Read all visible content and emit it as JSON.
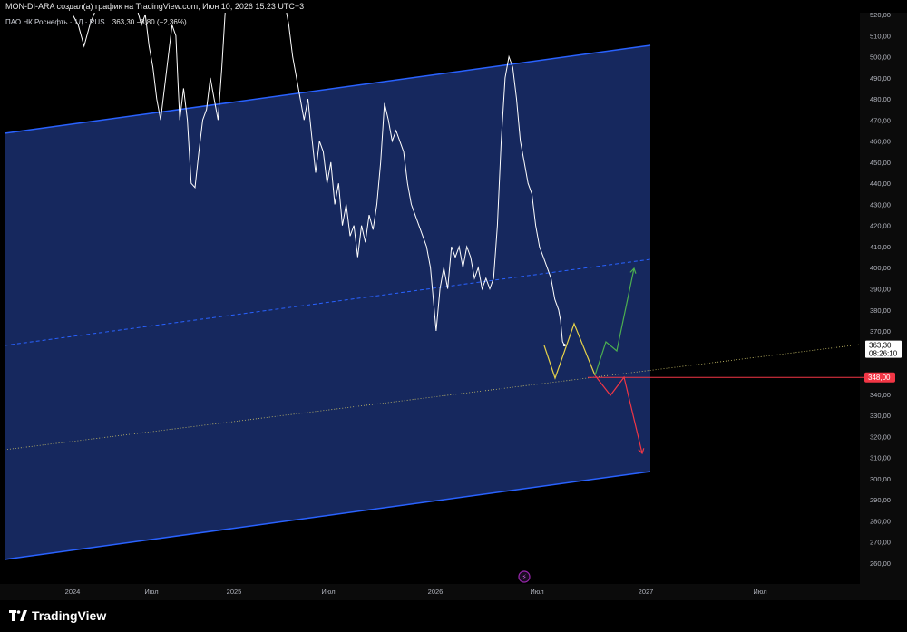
{
  "header": {
    "attribution": "MON-DI-ARA создал(а) график на TradingView.com, Июн 10, 2026 15:23 UTC+3"
  },
  "chart_data": {
    "type": "line",
    "symbol": "ПАО НК Роснефть · 1Д · RUS",
    "price_info": "363,30 −8,80 (−2,36%)",
    "x_ticks": [
      "2024",
      "Июл",
      "2025",
      "Июл",
      "2026",
      "Июл",
      "2027",
      "Июл"
    ],
    "y_ticks": [
      "520,00",
      "510,00",
      "500,00",
      "490,00",
      "480,00",
      "470,00",
      "460,00",
      "450,00",
      "440,00",
      "430,00",
      "420,00",
      "410,00",
      "400,00",
      "390,00",
      "380,00",
      "370,00",
      "360,00",
      "350,00",
      "340,00",
      "330,00",
      "320,00",
      "310,00",
      "300,00",
      "290,00",
      "280,00",
      "270,00",
      "260,00"
    ],
    "ylim": [
      255,
      521
    ],
    "last_price": {
      "value": 363.3,
      "label": "363,30",
      "countdown": "08:26:10"
    },
    "level_line": {
      "value": 348.0,
      "label": "348,00",
      "color": "#f23645"
    },
    "grid": false,
    "series": [
      {
        "values": [
          [
            2024.0,
            520
          ],
          [
            2024.03,
            515
          ],
          [
            2024.06,
            505
          ],
          [
            2024.09,
            515
          ],
          [
            2024.12,
            522
          ],
          [
            2024.15,
            530
          ],
          [
            2024.18,
            525
          ],
          [
            2024.21,
            535
          ],
          [
            2024.24,
            530
          ],
          [
            2024.27,
            535
          ],
          [
            2024.3,
            530
          ],
          [
            2024.33,
            525
          ],
          [
            2024.36,
            515
          ],
          [
            2024.38,
            520
          ],
          [
            2024.4,
            505
          ],
          [
            2024.42,
            495
          ],
          [
            2024.44,
            480
          ],
          [
            2024.46,
            470
          ],
          [
            2024.48,
            485
          ],
          [
            2024.5,
            500
          ],
          [
            2024.52,
            515
          ],
          [
            2024.54,
            510
          ],
          [
            2024.55,
            490
          ],
          [
            2024.56,
            470
          ],
          [
            2024.58,
            485
          ],
          [
            2024.6,
            470
          ],
          [
            2024.62,
            440
          ],
          [
            2024.64,
            438
          ],
          [
            2024.66,
            455
          ],
          [
            2024.68,
            470
          ],
          [
            2024.7,
            475
          ],
          [
            2024.72,
            490
          ],
          [
            2024.74,
            480
          ],
          [
            2024.76,
            470
          ],
          [
            2024.78,
            495
          ],
          [
            2024.8,
            525
          ],
          [
            2024.82,
            530
          ],
          [
            2024.84,
            525
          ],
          [
            2024.86,
            535
          ],
          [
            2024.88,
            530
          ],
          [
            2024.9,
            535
          ],
          [
            2024.93,
            530
          ],
          [
            2024.96,
            540
          ],
          [
            2025.0,
            535
          ],
          [
            2025.03,
            530
          ],
          [
            2025.06,
            540
          ],
          [
            2025.09,
            535
          ],
          [
            2025.11,
            525
          ],
          [
            2025.13,
            515
          ],
          [
            2025.15,
            500
          ],
          [
            2025.17,
            490
          ],
          [
            2025.19,
            480
          ],
          [
            2025.21,
            470
          ],
          [
            2025.23,
            480
          ],
          [
            2025.25,
            462
          ],
          [
            2025.27,
            445
          ],
          [
            2025.29,
            460
          ],
          [
            2025.31,
            455
          ],
          [
            2025.33,
            440
          ],
          [
            2025.35,
            450
          ],
          [
            2025.37,
            430
          ],
          [
            2025.39,
            440
          ],
          [
            2025.41,
            420
          ],
          [
            2025.43,
            430
          ],
          [
            2025.45,
            415
          ],
          [
            2025.47,
            420
          ],
          [
            2025.49,
            405
          ],
          [
            2025.51,
            420
          ],
          [
            2025.53,
            412
          ],
          [
            2025.55,
            425
          ],
          [
            2025.57,
            418
          ],
          [
            2025.59,
            430
          ],
          [
            2025.61,
            450
          ],
          [
            2025.63,
            478
          ],
          [
            2025.65,
            470
          ],
          [
            2025.67,
            460
          ],
          [
            2025.69,
            465
          ],
          [
            2025.71,
            460
          ],
          [
            2025.73,
            455
          ],
          [
            2025.75,
            440
          ],
          [
            2025.77,
            430
          ],
          [
            2025.79,
            425
          ],
          [
            2025.81,
            420
          ],
          [
            2025.83,
            415
          ],
          [
            2025.85,
            410
          ],
          [
            2025.87,
            400
          ],
          [
            2025.89,
            380
          ],
          [
            2025.9,
            370
          ],
          [
            2025.92,
            390
          ],
          [
            2025.94,
            400
          ],
          [
            2025.96,
            390
          ],
          [
            2025.98,
            410
          ],
          [
            2026.0,
            405
          ],
          [
            2026.02,
            410
          ],
          [
            2026.04,
            400
          ],
          [
            2026.06,
            410
          ],
          [
            2026.08,
            405
          ],
          [
            2026.1,
            395
          ],
          [
            2026.12,
            400
          ],
          [
            2026.14,
            390
          ],
          [
            2026.16,
            395
          ],
          [
            2026.18,
            390
          ],
          [
            2026.2,
            395
          ],
          [
            2026.22,
            420
          ],
          [
            2026.24,
            460
          ],
          [
            2026.26,
            490
          ],
          [
            2026.28,
            500
          ],
          [
            2026.3,
            495
          ],
          [
            2026.32,
            480
          ],
          [
            2026.34,
            460
          ],
          [
            2026.36,
            450
          ],
          [
            2026.38,
            440
          ],
          [
            2026.4,
            435
          ],
          [
            2026.42,
            420
          ],
          [
            2026.44,
            410
          ],
          [
            2026.46,
            405
          ],
          [
            2026.48,
            400
          ],
          [
            2026.5,
            395
          ],
          [
            2026.52,
            385
          ],
          [
            2026.54,
            380
          ],
          [
            2026.55,
            375
          ],
          [
            2026.56,
            365
          ],
          [
            2026.57,
            363.3
          ]
        ]
      }
    ]
  },
  "footer": {
    "logo_text": "TradingView"
  },
  "colors": {
    "background": "#000000",
    "channel_fill": "#172a63",
    "channel_line": "#2962ff",
    "price_line": "#ffffff",
    "projection_yellow": "#e6d24a",
    "projection_green": "#4caf50",
    "projection_red": "#f23645",
    "lightning_badge": "#9c27b0"
  }
}
